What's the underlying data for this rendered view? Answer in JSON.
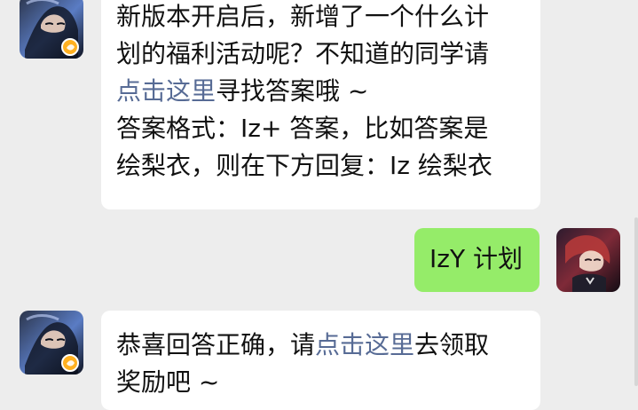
{
  "messages": [
    {
      "side": "left",
      "lines": [
        "新版本开启后，新增了一个什么计",
        "划的福利活动呢？不知道的同学请",
        "",
        "答案格式：Iz+ 答案，比如答案是",
        "绘梨衣，则在下方回复：Iz 绘梨衣"
      ],
      "link1": "点击这里",
      "after_link1": "寻找答案哦 ~"
    },
    {
      "side": "right",
      "text": "IzY 计划"
    },
    {
      "side": "left",
      "before_link": "恭喜回答正确，请",
      "link": "点击这里",
      "after_link": "去领取",
      "line2": "奖励吧 ~"
    }
  ],
  "colors": {
    "background": "#ededed",
    "left_bubble": "#ffffff",
    "right_bubble": "#95ec69",
    "link": "#576b95"
  }
}
